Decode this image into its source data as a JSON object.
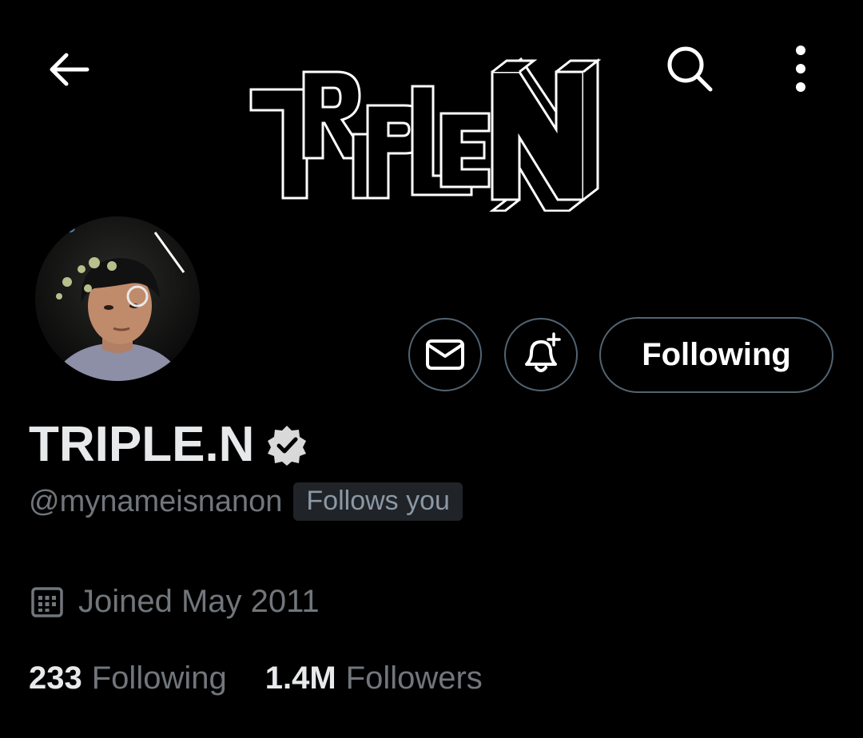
{
  "header": {
    "back_icon": "arrow-left-icon",
    "search_icon": "search-icon",
    "more_icon": "more-vertical-icon"
  },
  "banner": {
    "logo_text": "TRIPLE.N"
  },
  "actions": {
    "message_icon": "envelope-icon",
    "notify_icon": "bell-plus-icon",
    "following_label": "Following"
  },
  "profile": {
    "name": "TRIPLE.N",
    "verified_icon": "verified-badge-icon",
    "handle": "@mynameisnanon",
    "follows_you": "Follows you",
    "joined_icon": "calendar-icon",
    "joined": "Joined May 2011"
  },
  "stats": {
    "following_count": "233",
    "following_label": "Following",
    "followers_count": "1.4M",
    "followers_label": "Followers"
  },
  "colors": {
    "background": "#000000",
    "primary_text": "#e7e9ea",
    "secondary_text": "#71767b",
    "border": "#536471",
    "badge_bg": "#202327"
  }
}
